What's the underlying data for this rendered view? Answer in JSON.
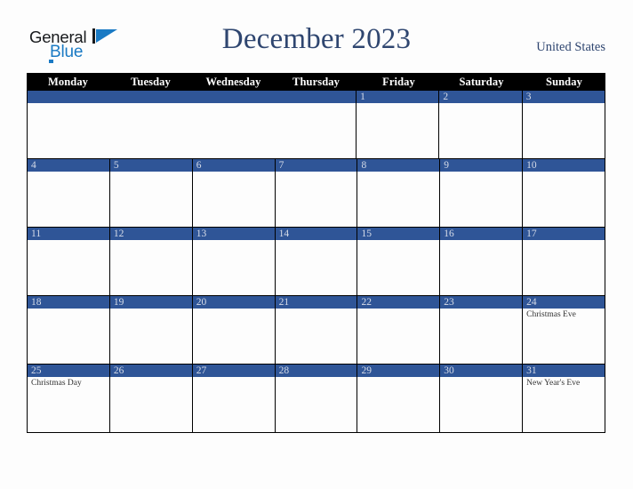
{
  "brand": {
    "word_one": "General",
    "word_two": "Blue",
    "logo_icon": "triangle-logo-icon",
    "accent_color": "#1a7ac4"
  },
  "header": {
    "title": "December 2023",
    "region": "United States",
    "title_color": "#2f4670"
  },
  "calendar": {
    "month": "December",
    "year": "2023",
    "weekday_headers": [
      "Monday",
      "Tuesday",
      "Wednesday",
      "Thursday",
      "Friday",
      "Saturday",
      "Sunday"
    ],
    "header_bg": "#000000",
    "date_band_color": "#2f5597",
    "cell_bg": "#fdfdfd",
    "weeks": [
      [
        {
          "date": "",
          "events": []
        },
        {
          "date": "",
          "events": []
        },
        {
          "date": "",
          "events": []
        },
        {
          "date": "",
          "events": []
        },
        {
          "date": "1",
          "events": []
        },
        {
          "date": "2",
          "events": []
        },
        {
          "date": "3",
          "events": []
        }
      ],
      [
        {
          "date": "4",
          "events": []
        },
        {
          "date": "5",
          "events": []
        },
        {
          "date": "6",
          "events": []
        },
        {
          "date": "7",
          "events": []
        },
        {
          "date": "8",
          "events": []
        },
        {
          "date": "9",
          "events": []
        },
        {
          "date": "10",
          "events": []
        }
      ],
      [
        {
          "date": "11",
          "events": []
        },
        {
          "date": "12",
          "events": []
        },
        {
          "date": "13",
          "events": []
        },
        {
          "date": "14",
          "events": []
        },
        {
          "date": "15",
          "events": []
        },
        {
          "date": "16",
          "events": []
        },
        {
          "date": "17",
          "events": []
        }
      ],
      [
        {
          "date": "18",
          "events": []
        },
        {
          "date": "19",
          "events": []
        },
        {
          "date": "20",
          "events": []
        },
        {
          "date": "21",
          "events": []
        },
        {
          "date": "22",
          "events": []
        },
        {
          "date": "23",
          "events": []
        },
        {
          "date": "24",
          "events": [
            "Christmas Eve"
          ]
        }
      ],
      [
        {
          "date": "25",
          "events": [
            "Christmas Day"
          ]
        },
        {
          "date": "26",
          "events": []
        },
        {
          "date": "27",
          "events": []
        },
        {
          "date": "28",
          "events": []
        },
        {
          "date": "29",
          "events": []
        },
        {
          "date": "30",
          "events": []
        },
        {
          "date": "31",
          "events": [
            "New Year's Eve"
          ]
        }
      ]
    ]
  }
}
